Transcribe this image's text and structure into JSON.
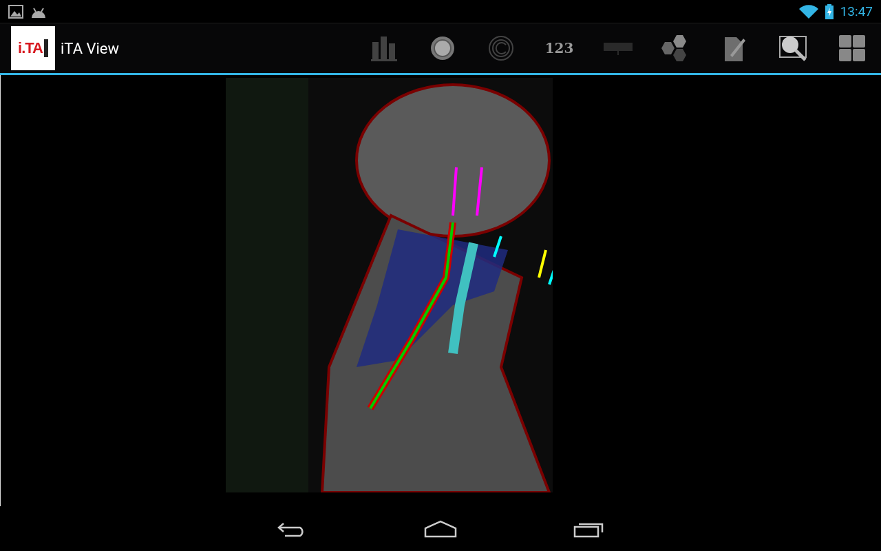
{
  "status_bar": {
    "time": "13:47"
  },
  "action_bar": {
    "logo": "i.TA",
    "title": "iTA View",
    "actions": [
      {
        "kind": "bars",
        "disabled": true
      },
      {
        "kind": "circle",
        "disabled": false
      },
      {
        "kind": "rings",
        "disabled": true
      },
      {
        "kind": "numbers",
        "label": "123",
        "disabled": false
      },
      {
        "kind": "ruler",
        "disabled": true
      },
      {
        "kind": "hexagons",
        "disabled": false
      },
      {
        "kind": "document",
        "disabled": false
      },
      {
        "kind": "magnifier",
        "disabled": false
      },
      {
        "kind": "grid",
        "disabled": false
      }
    ]
  },
  "nav_bar": [
    {
      "kind": "back"
    },
    {
      "kind": "home"
    },
    {
      "kind": "recents"
    }
  ]
}
